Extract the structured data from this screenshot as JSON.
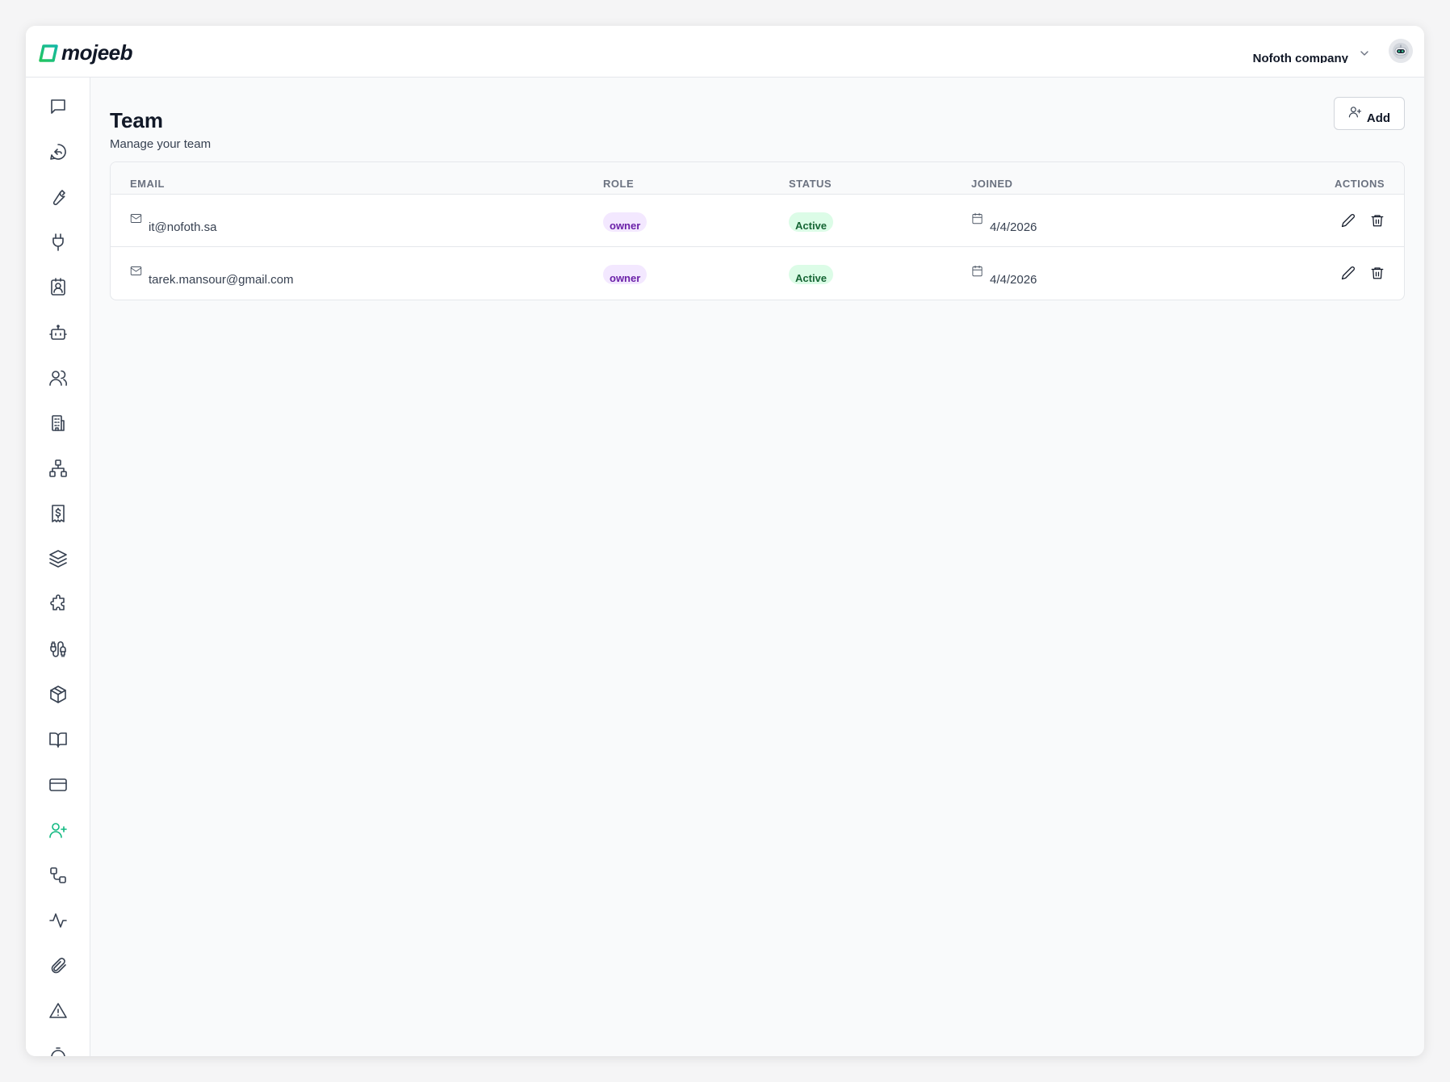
{
  "brand": {
    "name": "mojeeb",
    "accent": "#10b981"
  },
  "header": {
    "company_name": "Nofoth company",
    "company_chevron_icon": "chevron-down-icon",
    "avatar_icon": "robot-avatar-icon"
  },
  "sidebar": {
    "items": [
      {
        "icon": "message-square-icon",
        "active": false
      },
      {
        "icon": "message-reply-icon",
        "active": false
      },
      {
        "icon": "wrench-icon",
        "active": false
      },
      {
        "icon": "plug-icon",
        "active": false
      },
      {
        "icon": "contact-card-icon",
        "active": false
      },
      {
        "icon": "bot-icon",
        "active": false
      },
      {
        "icon": "users-icon",
        "active": false
      },
      {
        "icon": "building-icon",
        "active": false
      },
      {
        "icon": "hierarchy-icon",
        "active": false
      },
      {
        "icon": "receipt-dollar-icon",
        "active": false
      },
      {
        "icon": "layers-icon",
        "active": false
      },
      {
        "icon": "puzzle-icon",
        "active": false
      },
      {
        "icon": "cable-icon",
        "active": false
      },
      {
        "icon": "package-icon",
        "active": false
      },
      {
        "icon": "book-open-icon",
        "active": false
      },
      {
        "icon": "credit-card-icon",
        "active": false
      },
      {
        "icon": "user-plus-icon",
        "active": true
      },
      {
        "icon": "workflow-icon",
        "active": false
      },
      {
        "icon": "activity-icon",
        "active": false
      },
      {
        "icon": "paperclip-icon",
        "active": false
      },
      {
        "icon": "alert-triangle-icon",
        "active": false
      }
    ]
  },
  "page": {
    "title": "Team",
    "subtitle": "Manage your team",
    "add_label": "Add"
  },
  "table": {
    "columns": {
      "email": "EMAIL",
      "role": "ROLE",
      "status": "STATUS",
      "joined": "JOINED",
      "actions": "ACTIONS"
    },
    "rows": [
      {
        "email": "it@nofoth.sa",
        "role": "owner",
        "status": "Active",
        "joined": "4/4/2026"
      },
      {
        "email": "tarek.mansour@gmail.com",
        "role": "owner",
        "status": "Active",
        "joined": "4/4/2026"
      }
    ]
  }
}
